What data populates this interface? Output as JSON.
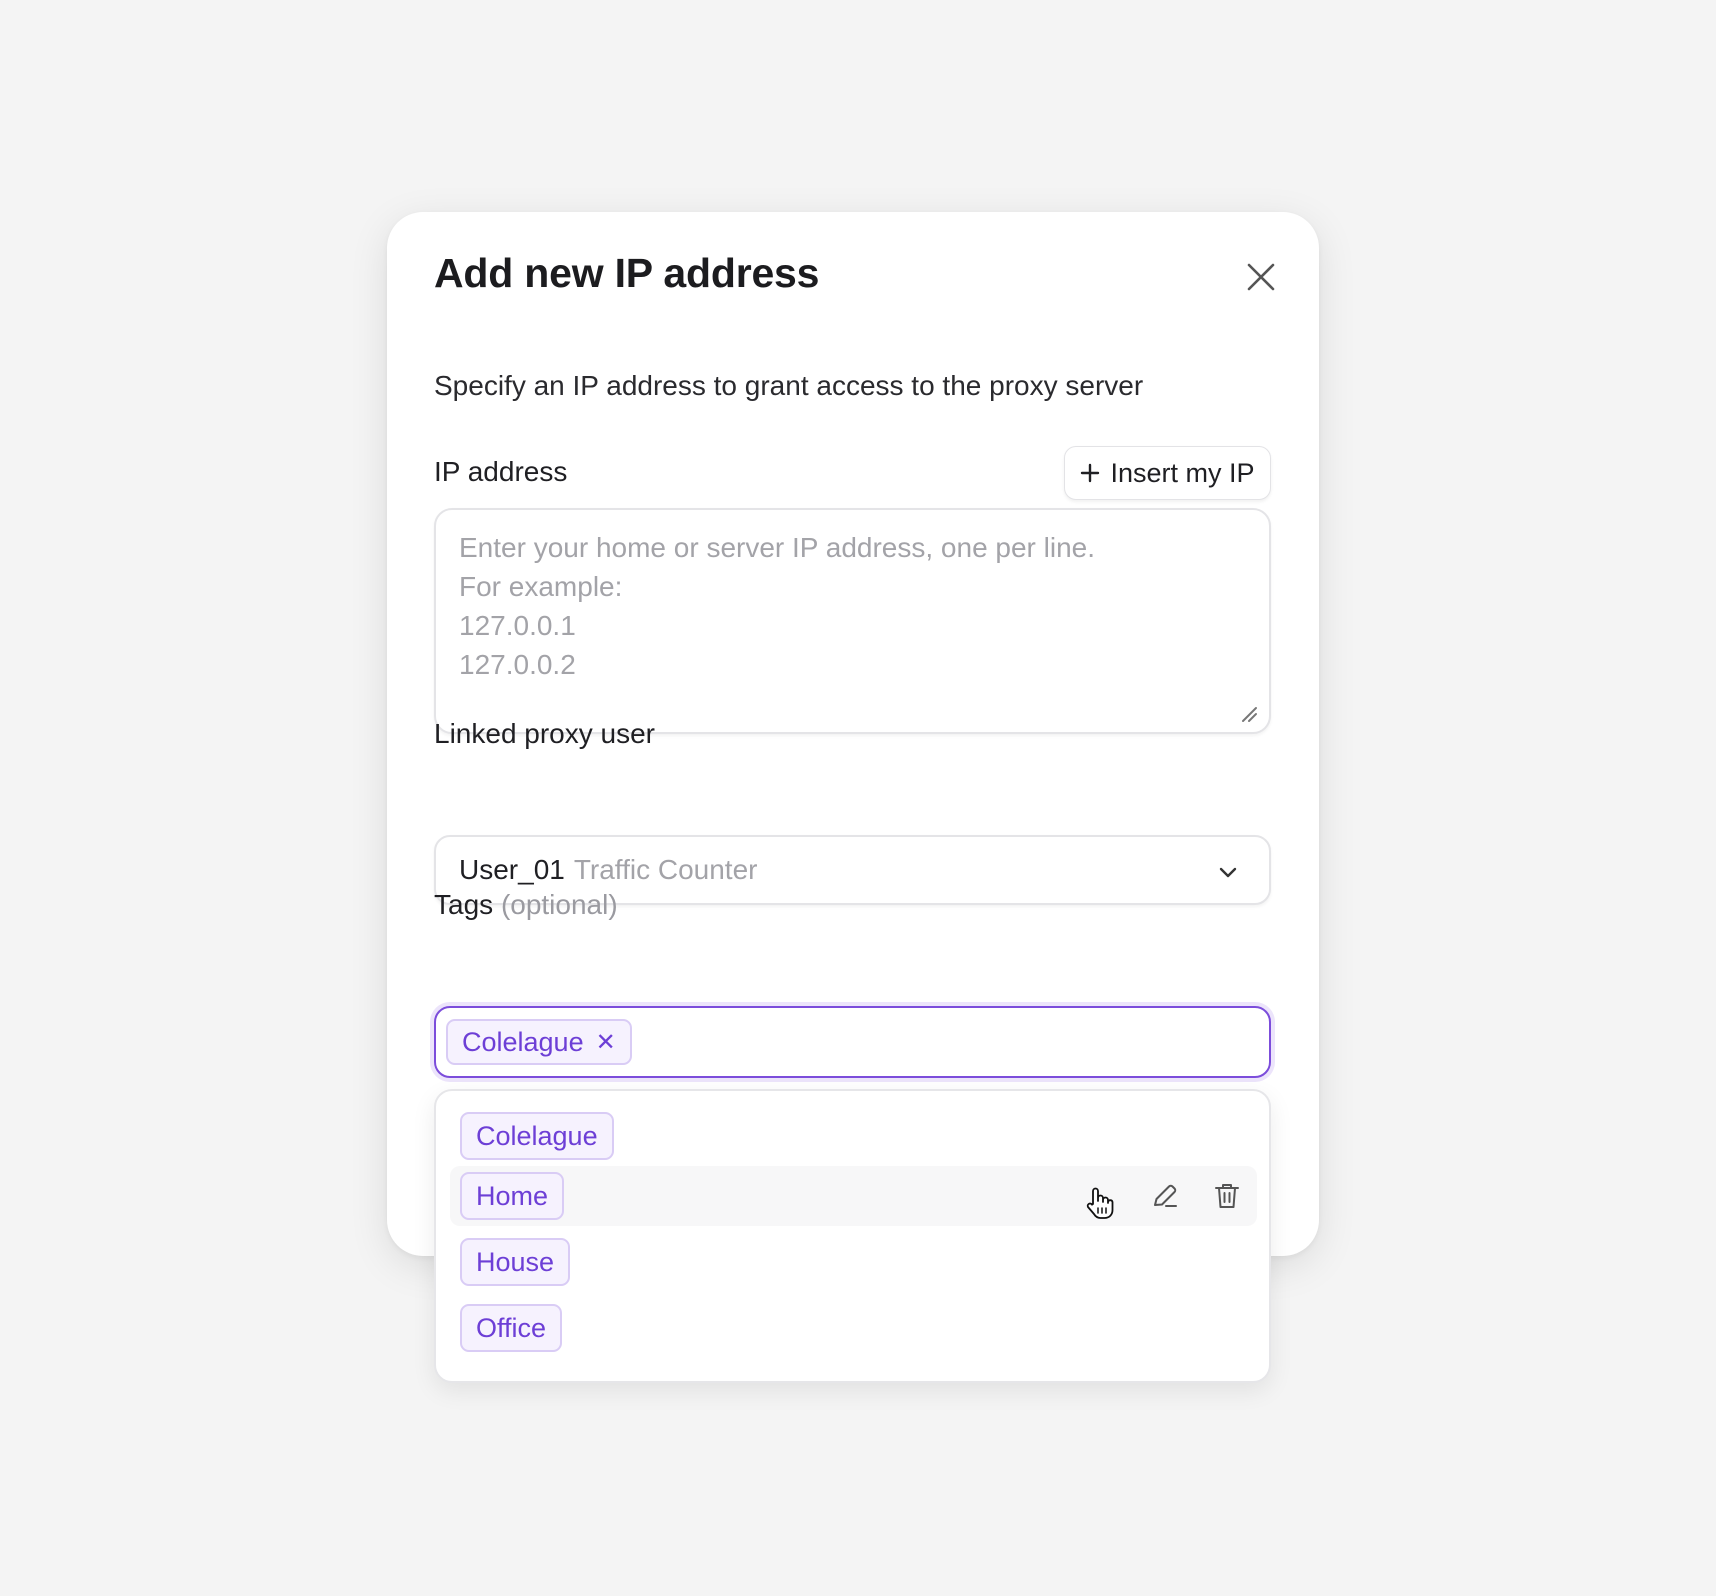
{
  "modal": {
    "title": "Add new IP address",
    "description": "Specify an IP address to grant access to the proxy server"
  },
  "ip_field": {
    "label": "IP address",
    "insert_button": "Insert my IP",
    "placeholder_lines": [
      "Enter your home or server IP address, one per line.",
      "For example:",
      "127.0.0.1",
      "127.0.0.2"
    ]
  },
  "proxy_user": {
    "label": "Linked proxy user",
    "selected_value": "User_01",
    "selected_sub": "Traffic Counter"
  },
  "tags": {
    "label": "Tags",
    "label_hint": "(optional)",
    "selected": [
      "Colelague"
    ],
    "options": [
      "Colelague",
      "Home",
      "House",
      "Office"
    ]
  },
  "colors": {
    "accent": "#7c4ddb",
    "chip_text": "#6d3fd6",
    "chip_bg": "#f6f2fe",
    "background": "#f4f4f4"
  },
  "icons": {
    "close": "close-icon",
    "plus": "plus-icon",
    "chevron": "chevron-down-icon",
    "edit": "pencil-icon",
    "delete": "trash-icon",
    "cursor": "hand-pointer-icon"
  }
}
